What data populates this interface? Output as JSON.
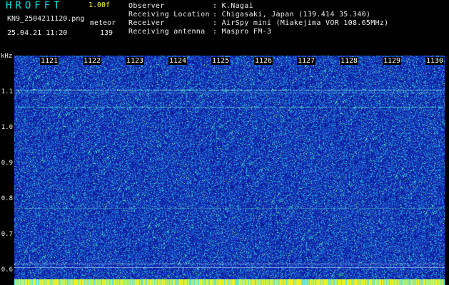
{
  "header": {
    "app_title": "HROFFT",
    "version": "1.00f",
    "file_name": "KN9_2504211120.png",
    "meteor_label": "meteor",
    "datetime": "25.04.21 11:20",
    "meteor_count": "139"
  },
  "info": [
    {
      "key": "Observer",
      "value": ": K.Nagai"
    },
    {
      "key": "Receiving Location",
      "value": ": Chigasaki, Japan (139.414 35.340)"
    },
    {
      "key": "Receiver",
      "value": ": AirSpy mini (Miakejima VOR 108.65MHz)"
    },
    {
      "key": "Receiving antenna",
      "value": ": Maspro FM-3"
    }
  ],
  "axis": {
    "unit": "kHz",
    "y_ticks": [
      "1.1",
      "1.0",
      "0.9",
      "0.8",
      "0.7",
      "0.6"
    ],
    "x_ticks": [
      "1121",
      "1122",
      "1123",
      "1124",
      "1125",
      "1126",
      "1127",
      "1128",
      "1129",
      "1130"
    ]
  },
  "colors": {
    "background": "#000000",
    "spectrogram_base": "#1a2aa0",
    "text_cyan": "#00e0e0",
    "text_white": "#f0f0f0",
    "text_yellow": "#ffff30"
  }
}
